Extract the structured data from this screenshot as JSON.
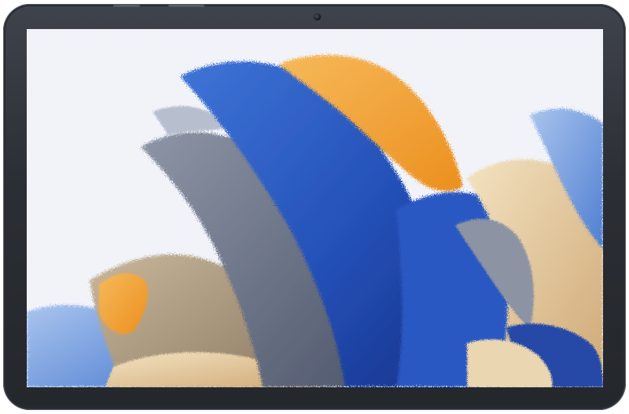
{
  "device": {
    "type": "tablet",
    "bezel_color": "#2f3238",
    "screen_background": "#f1f3f9"
  },
  "wallpaper": {
    "style": "abstract grainy brush strokes",
    "colors": {
      "deep_blue": "#2d5fc8",
      "light_blue": "#6f9ae0",
      "orange": "#f2a43a",
      "slate_gray": "#6f7788",
      "sand": "#e7cfa4",
      "tan": "#b8a58a"
    }
  }
}
